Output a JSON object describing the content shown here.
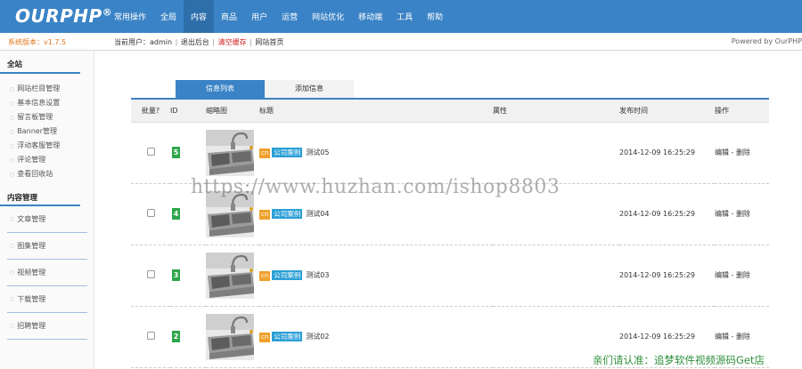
{
  "app": {
    "logo": "OURPHP",
    "logo_mark": "®"
  },
  "nav": [
    {
      "label": "常用操作",
      "active": false
    },
    {
      "label": "全局",
      "active": false
    },
    {
      "label": "内容",
      "active": true
    },
    {
      "label": "商品",
      "active": false
    },
    {
      "label": "用户",
      "active": false
    },
    {
      "label": "运营",
      "active": false
    },
    {
      "label": "网站优化",
      "active": false
    },
    {
      "label": "移动端",
      "active": false
    },
    {
      "label": "工具",
      "active": false
    },
    {
      "label": "帮助",
      "active": false
    }
  ],
  "subbar": {
    "version": "系统版本：v1.7.5",
    "current_user_label": "当前用户：admin",
    "logout": "退出后台",
    "clear_cache": "清空缓存",
    "site_home": "网站首页",
    "powered_by": "Powered by OurPHP"
  },
  "sidebar": {
    "section1_title": "全站",
    "section1_items": [
      "网站栏目管理",
      "基本信息设置",
      "留言板管理",
      "Banner管理",
      "浮动客服管理",
      "评论管理",
      "查看回收站"
    ],
    "section2_title": "内容管理",
    "section2_items": [
      "文章管理",
      "图集管理",
      "视频管理",
      "下载管理",
      "招聘管理"
    ]
  },
  "tabs": [
    {
      "label": "信息列表",
      "active": true
    },
    {
      "label": "添加信息",
      "active": false
    }
  ],
  "table": {
    "headers": {
      "batch": "批量?",
      "id": "ID",
      "thumb": "缩略图",
      "title": "标题",
      "attr": "属性",
      "date": "发布时间",
      "op": "操作"
    },
    "rows": [
      {
        "id": "5",
        "lang": "cn",
        "category": "公司案例",
        "title": "测试05",
        "date": "2014-12-09 16:25:29",
        "edit": "编辑",
        "sep": " - ",
        "delete": "删除"
      },
      {
        "id": "4",
        "lang": "cn",
        "category": "公司案例",
        "title": "测试04",
        "date": "2014-12-09 16:25:29",
        "edit": "编辑",
        "sep": " - ",
        "delete": "删除"
      },
      {
        "id": "3",
        "lang": "cn",
        "category": "公司案例",
        "title": "测试03",
        "date": "2014-12-09 16:25:29",
        "edit": "编辑",
        "sep": " - ",
        "delete": "删除"
      },
      {
        "id": "2",
        "lang": "cn",
        "category": "公司案例",
        "title": "测试02",
        "date": "2014-12-09 16:25:29",
        "edit": "编辑",
        "sep": " - ",
        "delete": "删除"
      }
    ]
  },
  "watermarks": {
    "url": "https://www.huzhan.com/ishop8803",
    "notice": "亲们请认准：追梦软件视频源码Get店"
  },
  "colors": {
    "brand_blue": "#3a83c6",
    "id_badge_green": "#2ea64a",
    "lang_badge_orange": "#f0a02c",
    "category_badge_blue": "#2a9fd6",
    "version_orange": "#e0761a"
  }
}
